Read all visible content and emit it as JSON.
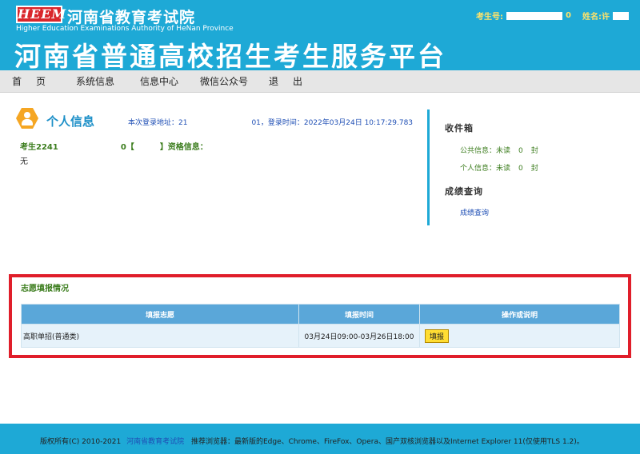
{
  "header": {
    "logo_text": "HEEM",
    "org_cn": "河南省教育考试院",
    "org_en": "Higher Education Examinations Authority of HeNan Province",
    "platform_title": "河南省普通高校招生考生服务平台",
    "exam_no_label": "考生号:",
    "exam_no_tail": "0",
    "name_label": "姓名:",
    "name_partial": "许"
  },
  "nav": [
    "首页",
    "系统信息",
    "信息中心",
    "微信公众号",
    "退出"
  ],
  "profile": {
    "title": "个人信息",
    "login_label": "本次登录地址：21",
    "login_suffix": "01，登录时间：2022年03月24日 10:17:29.783",
    "candidate_prefix": "考生2241",
    "candidate_mid": "0【",
    "candidate_suffix": "】资格信息：",
    "qualification": "无"
  },
  "sidebar": {
    "inbox_title": "收件箱",
    "public_label": "公共信息：未读",
    "public_count": "0",
    "personal_label": "个人信息：未读",
    "personal_count": "0",
    "unit": "封",
    "scores_title": "成绩查询",
    "scores_link": "成绩查询"
  },
  "volunteer": {
    "title": "志愿填报情况",
    "headers": [
      "填报志愿",
      "填报时间",
      "操作或说明"
    ],
    "rows": [
      {
        "name": "高职单招(普通类)",
        "time": "03月24日09:00-03月26日18:00",
        "action": "填报"
      }
    ]
  },
  "footer": {
    "copyright": "版权所有(C) 2010-2021",
    "org_link": "河南省教育考试院",
    "browsers": "推荐浏览器：最新版的Edge、Chrome、FireFox、Opera、国产双核浏览器以及Internet Explorer 11(仅使用TLS 1.2)。"
  },
  "colors": {
    "header_blue": "#1ea9d6",
    "highlight_red": "#e01e2a",
    "table_header": "#5aa7d9",
    "button_yellow": "#ffdd33"
  }
}
